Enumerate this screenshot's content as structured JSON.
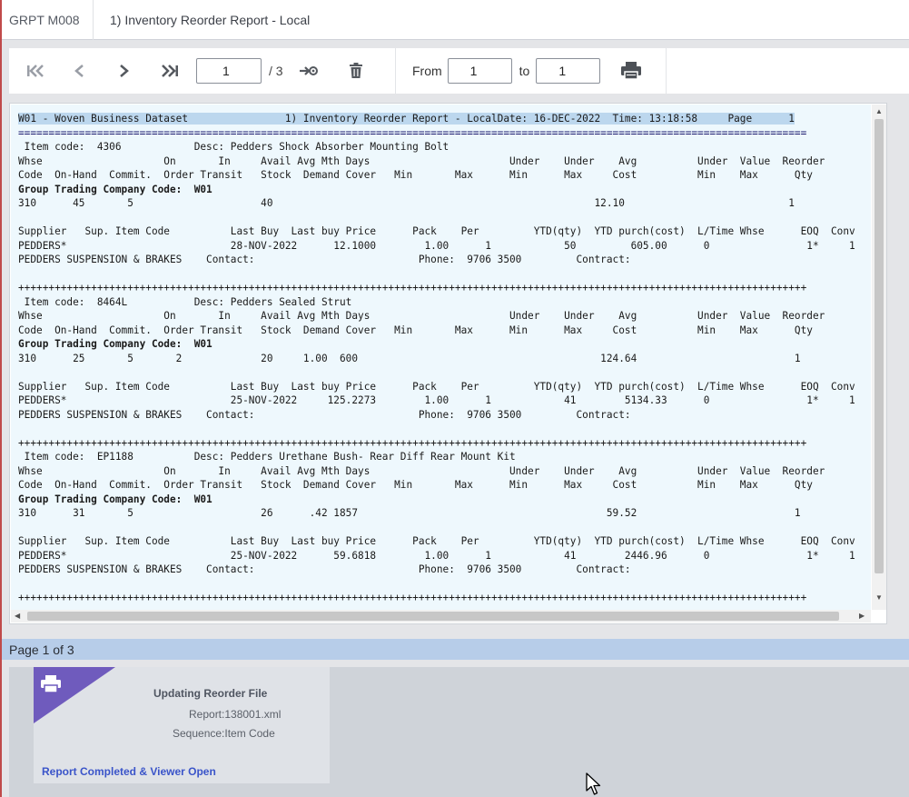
{
  "header": {
    "program_code": "GRPT M008",
    "tab_title": "1) Inventory Reorder Report - Local"
  },
  "toolbar": {
    "current_page": "1",
    "total_pages_label": "/ 3",
    "from_label": "From",
    "from_value": "1",
    "to_label": "to",
    "to_value": "1",
    "icons": [
      "first-page-icon",
      "previous-page-icon",
      "next-page-icon",
      "last-page-icon",
      "go-to-page-icon",
      "trash-icon",
      "printer-icon"
    ]
  },
  "report": {
    "lines": [
      "W01 - Woven Business Dataset                1) Inventory Reorder Report - LocalDate: 16-DEC-2022  Time: 13:18:58     Page      1",
      "==================================================================================================================================",
      " Item code:  4306            Desc: Pedders Shock Absorber Mounting Bolt",
      "Whse                    On       In     Avail Avg Mth Days                       Under    Under    Avg          Under  Value  Reorder",
      "Code  On-Hand  Commit.  Order Transit   Stock  Demand Cover   Min       Max      Min      Max     Cost          Min    Max      Qty",
      "Group Trading Company Code:  W01",
      "310      45       5                     40                                                     12.10                           1",
      "",
      "Supplier   Sup. Item Code          Last Buy  Last buy Price      Pack    Per         YTD(qty)  YTD purch(cost)  L/Time Whse      EOQ  Conv",
      "PEDDERS*                           28-NOV-2022      12.1000        1.00      1            50         605.00      0                1*     1",
      "PEDDERS SUSPENSION & BRAKES    Contact:                           Phone:  9706 3500         Contract:",
      "",
      "++++++++++++++++++++++++++++++++++++++++++++++++++++++++++++++++++++++++++++++++++++++++++++++++++++++++++++++++++++++++++++++++++",
      " Item code:  8464L           Desc: Pedders Sealed Strut",
      "Whse                    On       In     Avail Avg Mth Days                       Under    Under    Avg          Under  Value  Reorder",
      "Code  On-Hand  Commit.  Order Transit   Stock  Demand Cover   Min       Max      Min      Max     Cost          Min    Max      Qty",
      "Group Trading Company Code:  W01",
      "310      25       5       2             20     1.00  600                                        124.64                          1",
      "",
      "Supplier   Sup. Item Code          Last Buy  Last buy Price      Pack    Per         YTD(qty)  YTD purch(cost)  L/Time Whse      EOQ  Conv",
      "PEDDERS*                           25-NOV-2022     125.2273        1.00      1            41        5134.33      0                1*     1",
      "PEDDERS SUSPENSION & BRAKES    Contact:                           Phone:  9706 3500         Contract:",
      "",
      "++++++++++++++++++++++++++++++++++++++++++++++++++++++++++++++++++++++++++++++++++++++++++++++++++++++++++++++++++++++++++++++++++",
      " Item code:  EP1188          Desc: Pedders Urethane Bush- Rear Diff Rear Mount Kit",
      "Whse                    On       In     Avail Avg Mth Days                       Under    Under    Avg          Under  Value  Reorder",
      "Code  On-Hand  Commit.  Order Transit   Stock  Demand Cover   Min       Max      Min      Max     Cost          Min    Max      Qty",
      "Group Trading Company Code:  W01",
      "310      31       5                     26      .42 1857                                         59.52                          1",
      "",
      "Supplier   Sup. Item Code          Last Buy  Last buy Price      Pack    Per         YTD(qty)  YTD purch(cost)  L/Time Whse      EOQ  Conv",
      "PEDDERS*                           25-NOV-2022      59.6818        1.00      1            41        2446.96      0                1*     1",
      "PEDDERS SUSPENSION & BRAKES    Contact:                           Phone:  9706 3500         Contract:",
      "",
      "++++++++++++++++++++++++++++++++++++++++++++++++++++++++++++++++++++++++++++++++++++++++++++++++++++++++++++++++++++++++++++++++++"
    ]
  },
  "status": {
    "page_label": "Page 1 of 3"
  },
  "notification": {
    "title": "Updating Reorder File",
    "report": "Report:138001.xml",
    "sequence": "Sequence:Item Code",
    "link": "Report Completed & Viewer Open"
  },
  "colors": {
    "accent_purple": "#6f5bbd",
    "link_blue": "#3a54c9",
    "report_bg": "#eef8fd",
    "status_bar": "#b7cde9"
  }
}
